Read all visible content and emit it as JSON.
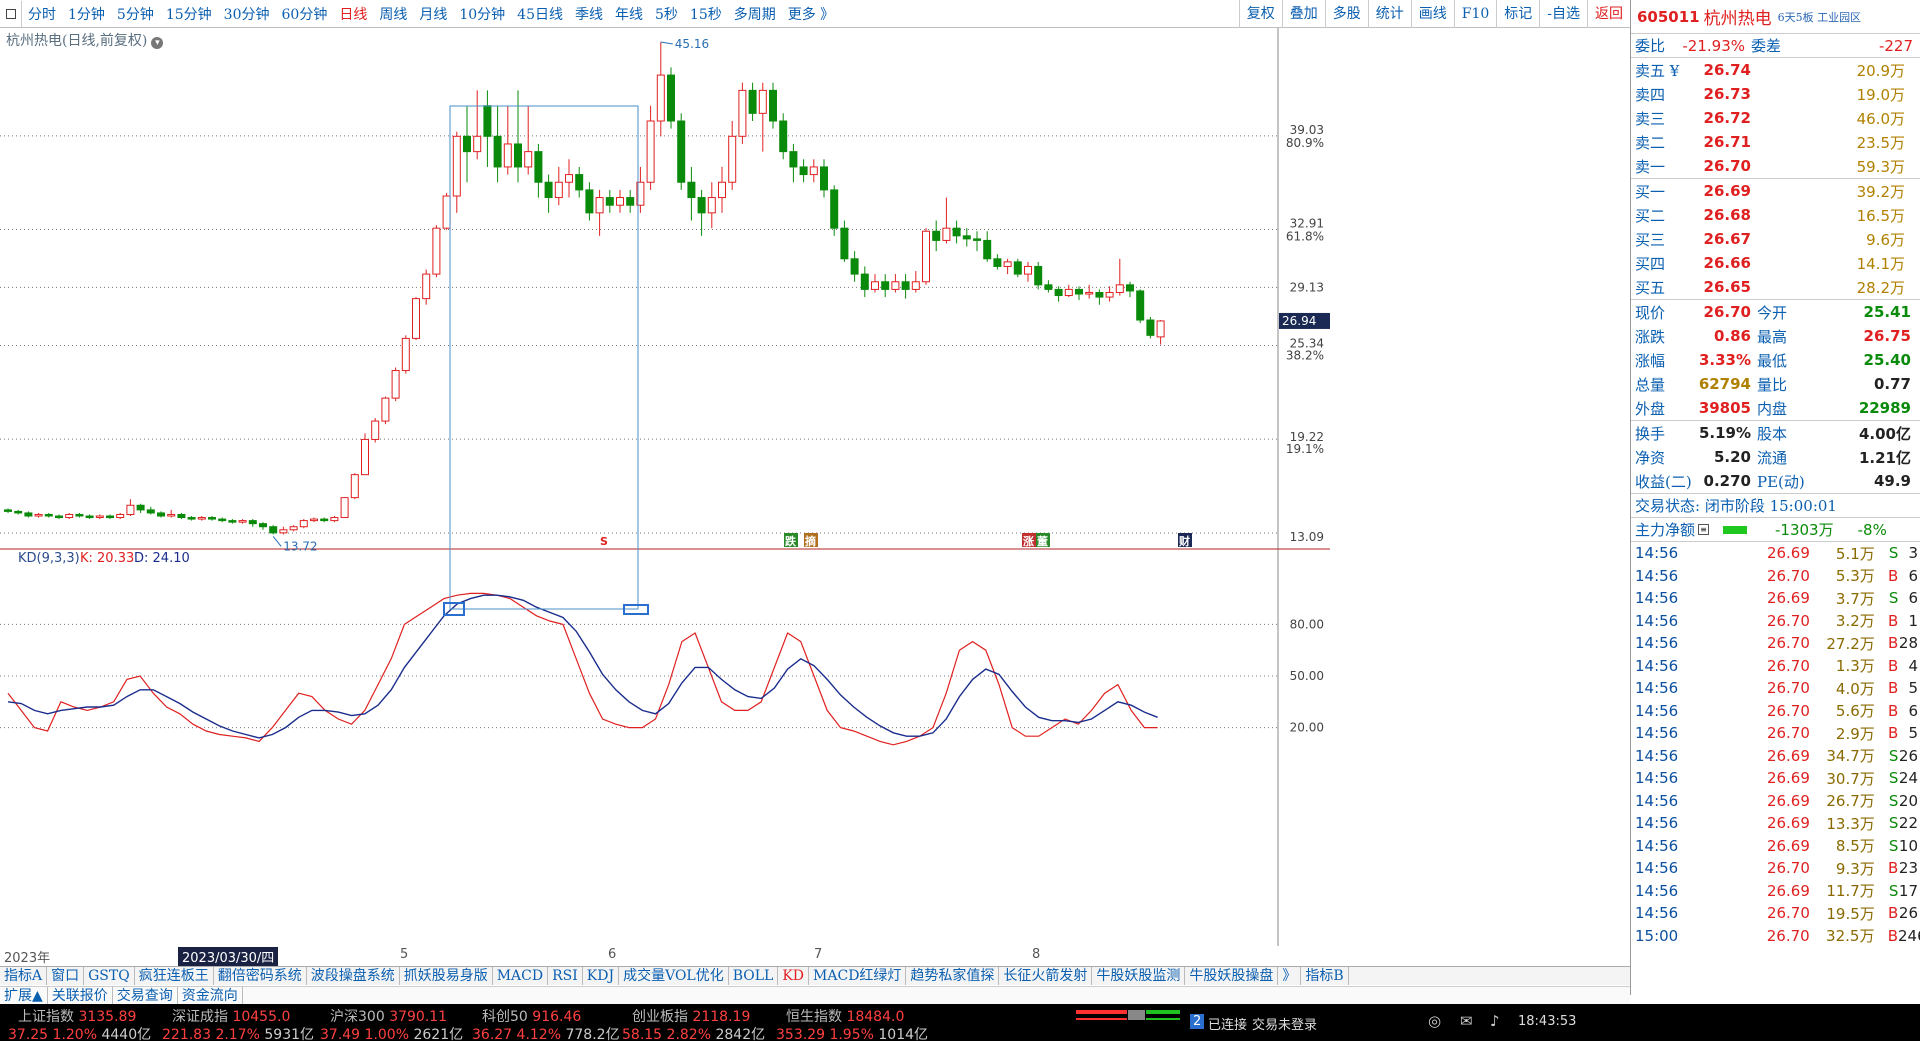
{
  "toolbar": {
    "periods": [
      "分时",
      "1分钟",
      "5分钟",
      "15分钟",
      "30分钟",
      "60分钟",
      "日线",
      "周线",
      "月线",
      "10分钟",
      "45日线",
      "季线",
      "年线",
      "5秒",
      "15秒",
      "多周期",
      "更多 》"
    ],
    "active_period": "日线",
    "right": [
      "复权",
      "叠加",
      "多股",
      "统计",
      "画线",
      "F10",
      "标记",
      "-自选",
      "返回"
    ]
  },
  "chart": {
    "title": "杭州热电(日线,前复权)",
    "price_labels": [
      "39.03",
      "80.9%",
      "32.91",
      "61.8%",
      "29.13",
      "25.34",
      "38.2%",
      "19.22",
      "19.1%",
      "13.09"
    ],
    "current_price_tag": "26.94",
    "high_label": "45.16",
    "low_label": "13.72",
    "event_markers": [
      "S",
      "跌",
      "摘",
      "涨",
      "董",
      "财"
    ],
    "kd_label": "KD(9,3,3)",
    "kd_k": "K: 20.33",
    "kd_d": "D: 24.10",
    "kd_levels": [
      "80.00",
      "50.00",
      "20.00"
    ],
    "x_labels": [
      "2023年",
      "2023/03/30/四",
      "5",
      "6",
      "7",
      "8"
    ]
  },
  "chart_data": {
    "type": "candlestick",
    "title": "杭州热电(日线,前复权)",
    "ylim": [
      13.09,
      45.16
    ],
    "candles": [
      [
        14.6,
        14.5,
        14.7,
        14.4
      ],
      [
        14.5,
        14.4,
        14.6,
        14.3
      ],
      [
        14.4,
        14.2,
        14.5,
        14.1
      ],
      [
        14.2,
        14.3,
        14.4,
        14.1
      ],
      [
        14.3,
        14.2,
        14.4,
        14.1
      ],
      [
        14.2,
        14.1,
        14.3,
        14.0
      ],
      [
        14.1,
        14.3,
        14.4,
        14.0
      ],
      [
        14.3,
        14.2,
        14.4,
        14.1
      ],
      [
        14.2,
        14.1,
        14.3,
        14.0
      ],
      [
        14.1,
        14.2,
        14.3,
        14.0
      ],
      [
        14.2,
        14.1,
        14.3,
        14.0
      ],
      [
        14.1,
        14.3,
        14.4,
        14.0
      ],
      [
        14.3,
        14.9,
        15.3,
        14.2
      ],
      [
        14.9,
        14.6,
        15.0,
        14.4
      ],
      [
        14.6,
        14.4,
        14.8,
        14.3
      ],
      [
        14.4,
        14.2,
        14.5,
        14.1
      ],
      [
        14.2,
        14.3,
        14.6,
        14.1
      ],
      [
        14.3,
        14.1,
        14.4,
        14.0
      ],
      [
        14.1,
        14.0,
        14.2,
        13.9
      ],
      [
        14.0,
        14.1,
        14.2,
        13.9
      ],
      [
        14.1,
        14.0,
        14.2,
        13.9
      ],
      [
        14.0,
        13.9,
        14.1,
        13.8
      ],
      [
        13.9,
        13.8,
        14.0,
        13.7
      ],
      [
        13.8,
        13.9,
        14.0,
        13.7
      ],
      [
        13.9,
        13.7,
        14.0,
        13.5
      ],
      [
        13.7,
        13.5,
        13.8,
        13.3
      ],
      [
        13.5,
        13.1,
        13.6,
        13.0
      ],
      [
        13.1,
        13.3,
        13.5,
        13.0
      ],
      [
        13.3,
        13.5,
        13.6,
        13.2
      ],
      [
        13.5,
        13.9,
        14.0,
        13.4
      ],
      [
        13.9,
        14.0,
        14.1,
        13.8
      ],
      [
        14.0,
        13.9,
        14.1,
        13.8
      ],
      [
        13.9,
        14.1,
        14.2,
        13.8
      ],
      [
        14.1,
        15.4,
        15.4,
        14.1
      ],
      [
        15.4,
        16.9,
        17.0,
        15.3
      ],
      [
        16.9,
        19.2,
        19.6,
        16.9
      ],
      [
        19.2,
        20.4,
        20.6,
        19.0
      ],
      [
        20.4,
        21.9,
        22.0,
        20.2
      ],
      [
        21.9,
        23.7,
        23.9,
        21.7
      ],
      [
        23.7,
        25.8,
        26.0,
        23.5
      ],
      [
        25.8,
        28.4,
        28.5,
        25.7
      ],
      [
        28.4,
        30.0,
        30.3,
        28.0
      ],
      [
        30.0,
        33.0,
        33.2,
        29.8
      ],
      [
        33.0,
        35.1,
        35.3,
        32.9
      ],
      [
        35.1,
        39.0,
        39.3,
        34.0
      ],
      [
        39.0,
        38.0,
        41.0,
        36.0
      ],
      [
        38.0,
        39.0,
        42.0,
        37.5
      ],
      [
        41.0,
        39.0,
        42.0,
        37.0
      ],
      [
        39.0,
        37.0,
        41.0,
        36.0
      ],
      [
        37.0,
        38.5,
        41.0,
        36.5
      ],
      [
        38.5,
        37.0,
        42.0,
        36.0
      ],
      [
        37.0,
        38.0,
        41.0,
        36.5
      ],
      [
        38.0,
        36.0,
        38.5,
        35.0
      ],
      [
        36.0,
        35.0,
        36.5,
        34.0
      ],
      [
        35.0,
        36.0,
        37.0,
        34.5
      ],
      [
        36.0,
        36.5,
        37.5,
        35.0
      ],
      [
        36.5,
        35.5,
        37.0,
        35.0
      ],
      [
        35.5,
        34.0,
        36.0,
        33.5
      ],
      [
        34.0,
        35.0,
        35.5,
        32.5
      ],
      [
        35.0,
        34.5,
        35.5,
        34.0
      ],
      [
        34.5,
        35.0,
        35.5,
        34.0
      ],
      [
        35.0,
        34.5,
        35.5,
        34.0
      ],
      [
        34.5,
        36.0,
        37.0,
        34.0
      ],
      [
        36.0,
        40.0,
        41.0,
        35.5
      ],
      [
        40.0,
        43.0,
        45.16,
        39.0
      ],
      [
        43.0,
        40.0,
        43.5,
        39.5
      ],
      [
        40.0,
        36.0,
        40.5,
        35.5
      ],
      [
        36.0,
        35.0,
        37.0,
        33.5
      ],
      [
        35.0,
        34.0,
        35.5,
        32.5
      ],
      [
        34.0,
        35.0,
        36.0,
        33.0
      ],
      [
        35.0,
        36.0,
        37.0,
        34.0
      ],
      [
        36.0,
        39.0,
        40.0,
        35.5
      ],
      [
        39.0,
        42.0,
        42.5,
        38.5
      ],
      [
        42.0,
        40.5,
        42.5,
        40.0
      ],
      [
        40.5,
        42.0,
        42.5,
        38.0
      ],
      [
        42.0,
        40.0,
        42.5,
        39.5
      ],
      [
        40.0,
        38.0,
        40.5,
        37.5
      ],
      [
        38.0,
        37.0,
        38.5,
        36.0
      ],
      [
        37.0,
        36.5,
        37.5,
        36.0
      ],
      [
        36.5,
        37.0,
        37.5,
        36.0
      ],
      [
        37.0,
        35.5,
        37.5,
        35.0
      ],
      [
        35.5,
        33.0,
        35.8,
        32.5
      ],
      [
        33.0,
        31.0,
        33.5,
        30.8
      ],
      [
        31.0,
        30.0,
        31.5,
        29.5
      ],
      [
        30.0,
        29.0,
        30.5,
        28.5
      ],
      [
        29.0,
        29.5,
        30.0,
        28.8
      ],
      [
        29.5,
        29.0,
        30.0,
        28.5
      ],
      [
        29.0,
        29.5,
        30.0,
        28.8
      ],
      [
        29.5,
        29.0,
        30.0,
        28.4
      ],
      [
        29.0,
        29.5,
        30.2,
        28.8
      ],
      [
        29.5,
        32.8,
        33.0,
        29.3
      ],
      [
        32.8,
        32.2,
        33.5,
        31.5
      ],
      [
        32.2,
        33.0,
        35.0,
        32.0
      ],
      [
        33.0,
        32.5,
        33.5,
        32.0
      ],
      [
        32.5,
        32.3,
        33.0,
        31.8
      ],
      [
        32.3,
        32.2,
        32.8,
        31.5
      ],
      [
        32.2,
        31.0,
        32.8,
        30.8
      ],
      [
        31.0,
        30.5,
        31.3,
        30.3
      ],
      [
        30.5,
        30.8,
        31.0,
        30.0
      ],
      [
        30.8,
        30.0,
        31.0,
        29.8
      ],
      [
        30.0,
        30.5,
        30.8,
        29.5
      ],
      [
        30.5,
        29.3,
        30.8,
        29.0
      ],
      [
        29.3,
        29.0,
        29.6,
        28.8
      ],
      [
        29.0,
        28.6,
        29.2,
        28.2
      ],
      [
        28.6,
        29.0,
        29.3,
        28.5
      ],
      [
        29.0,
        28.7,
        29.2,
        28.3
      ],
      [
        28.7,
        28.8,
        29.3,
        28.4
      ],
      [
        28.8,
        28.5,
        29.0,
        28.0
      ],
      [
        28.5,
        28.8,
        29.2,
        28.2
      ],
      [
        28.8,
        29.3,
        31.0,
        28.6
      ],
      [
        29.3,
        28.9,
        29.5,
        28.5
      ],
      [
        28.9,
        27.0,
        29.0,
        26.8
      ],
      [
        27.0,
        26.0,
        27.2,
        25.8
      ],
      [
        25.9,
        26.94,
        27.0,
        25.4
      ]
    ],
    "kd": {
      "k": [
        40,
        30,
        20,
        18,
        35,
        32,
        30,
        32,
        35,
        48,
        50,
        40,
        32,
        28,
        22,
        18,
        16,
        15,
        14,
        12,
        20,
        30,
        40,
        38,
        30,
        25,
        22,
        30,
        45,
        60,
        80,
        85,
        90,
        95,
        97,
        98,
        98,
        97,
        95,
        90,
        85,
        82,
        80,
        60,
        40,
        25,
        22,
        20,
        20,
        25,
        45,
        70,
        75,
        55,
        35,
        30,
        30,
        35,
        55,
        75,
        70,
        50,
        30,
        20,
        18,
        15,
        12,
        10,
        12,
        15,
        20,
        40,
        65,
        70,
        65,
        45,
        20,
        15,
        15,
        20,
        25,
        22,
        30,
        40,
        45,
        30,
        20,
        20
      ],
      "d": [
        35,
        34,
        30,
        28,
        30,
        31,
        32,
        32,
        33,
        38,
        42,
        42,
        38,
        34,
        29,
        25,
        21,
        18,
        16,
        14,
        16,
        20,
        26,
        30,
        30,
        29,
        27,
        28,
        33,
        42,
        55,
        65,
        75,
        85,
        92,
        95,
        97,
        97,
        96,
        94,
        90,
        87,
        84,
        76,
        64,
        51,
        42,
        35,
        30,
        28,
        34,
        46,
        55,
        55,
        48,
        42,
        38,
        37,
        43,
        54,
        60,
        56,
        48,
        39,
        32,
        26,
        21,
        17,
        15,
        15,
        17,
        25,
        38,
        48,
        54,
        51,
        41,
        32,
        26,
        24,
        24,
        23,
        25,
        30,
        35,
        33,
        29,
        26
      ]
    }
  },
  "quote": {
    "code": "605011",
    "name": "杭州热电",
    "industry": "6天5板 工业园区",
    "weibi_label": "委比",
    "weibi_value": "-21.93%",
    "weicha_label": "委差",
    "weicha_value": "-227",
    "asks": [
      {
        "label": "卖五 ¥",
        "price": "26.74",
        "vol": "20.9万"
      },
      {
        "label": "卖四",
        "price": "26.73",
        "vol": "19.0万"
      },
      {
        "label": "卖三",
        "price": "26.72",
        "vol": "46.0万"
      },
      {
        "label": "卖二",
        "price": "26.71",
        "vol": "23.5万"
      },
      {
        "label": "卖一",
        "price": "26.70",
        "vol": "59.3万"
      }
    ],
    "bids": [
      {
        "label": "买一",
        "price": "26.69",
        "vol": "39.2万"
      },
      {
        "label": "买二",
        "price": "26.68",
        "vol": "16.5万"
      },
      {
        "label": "买三",
        "price": "26.67",
        "vol": "9.6万"
      },
      {
        "label": "买四",
        "price": "26.66",
        "vol": "14.1万"
      },
      {
        "label": "买五",
        "price": "26.65",
        "vol": "28.2万"
      }
    ],
    "stats": [
      {
        "l1": "现价",
        "v1": "26.70",
        "c1": "red",
        "l2": "今开",
        "v2": "25.41",
        "c2": "green"
      },
      {
        "l1": "涨跌",
        "v1": "0.86",
        "c1": "red",
        "l2": "最高",
        "v2": "26.75",
        "c2": "red"
      },
      {
        "l1": "涨幅",
        "v1": "3.33%",
        "c1": "red",
        "l2": "最低",
        "v2": "25.40",
        "c2": "green"
      },
      {
        "l1": "总量",
        "v1": "62794",
        "c1": "gold",
        "l2": "量比",
        "v2": "0.77",
        "c2": "dark"
      },
      {
        "l1": "外盘",
        "v1": "39805",
        "c1": "red",
        "l2": "内盘",
        "v2": "22989",
        "c2": "green"
      }
    ],
    "stats2": [
      {
        "l1": "换手",
        "v1": "5.19%",
        "c1": "dark",
        "l2": "股本",
        "v2": "4.00亿",
        "c2": "dark"
      },
      {
        "l1": "净资",
        "v1": "5.20",
        "c1": "dark",
        "l2": "流通",
        "v2": "1.21亿",
        "c2": "dark"
      },
      {
        "l1": "收益(二)",
        "v1": "0.270",
        "c1": "dark",
        "l2": "PE(动)",
        "v2": "49.9",
        "c2": "dark"
      }
    ],
    "trade_state": "交易状态: 闭市阶段 15:00:01",
    "main_net_label": "主力净额",
    "main_net_value": "-1303万",
    "main_net_pct": "-8%"
  },
  "ticks": [
    {
      "t": "14:56",
      "p": "26.69",
      "v": "5.1万",
      "bs": "S",
      "n": "3"
    },
    {
      "t": "14:56",
      "p": "26.70",
      "v": "5.3万",
      "bs": "B",
      "n": "6"
    },
    {
      "t": "14:56",
      "p": "26.69",
      "v": "3.7万",
      "bs": "S",
      "n": "6"
    },
    {
      "t": "14:56",
      "p": "26.70",
      "v": "3.2万",
      "bs": "B",
      "n": "1"
    },
    {
      "t": "14:56",
      "p": "26.70",
      "v": "27.2万",
      "bs": "B",
      "n": "28"
    },
    {
      "t": "14:56",
      "p": "26.70",
      "v": "1.3万",
      "bs": "B",
      "n": "4"
    },
    {
      "t": "14:56",
      "p": "26.70",
      "v": "4.0万",
      "bs": "B",
      "n": "5"
    },
    {
      "t": "14:56",
      "p": "26.70",
      "v": "5.6万",
      "bs": "B",
      "n": "6"
    },
    {
      "t": "14:56",
      "p": "26.70",
      "v": "2.9万",
      "bs": "B",
      "n": "5"
    },
    {
      "t": "14:56",
      "p": "26.69",
      "v": "34.7万",
      "bs": "S",
      "n": "26"
    },
    {
      "t": "14:56",
      "p": "26.69",
      "v": "30.7万",
      "bs": "S",
      "n": "24"
    },
    {
      "t": "14:56",
      "p": "26.69",
      "v": "26.7万",
      "bs": "S",
      "n": "20"
    },
    {
      "t": "14:56",
      "p": "26.69",
      "v": "13.3万",
      "bs": "S",
      "n": "22"
    },
    {
      "t": "14:56",
      "p": "26.69",
      "v": "8.5万",
      "bs": "S",
      "n": "10"
    },
    {
      "t": "14:56",
      "p": "26.70",
      "v": "9.3万",
      "bs": "B",
      "n": "23"
    },
    {
      "t": "14:56",
      "p": "26.69",
      "v": "11.7万",
      "bs": "S",
      "n": "17"
    },
    {
      "t": "14:56",
      "p": "26.70",
      "v": "19.5万",
      "bs": "B",
      "n": "26"
    },
    {
      "t": "15:00",
      "p": "26.70",
      "v": "32.5万",
      "bs": "B",
      "n": "246"
    }
  ],
  "tabs1": [
    "指标A",
    "窗口",
    "GSTQ",
    "疯狂连板王",
    "翻倍密码系统",
    "波段操盘系统",
    "抓妖股易身版",
    "MACD",
    "RSI",
    "KDJ",
    "成交量VOL优化",
    "BOLL",
    "KD",
    "MACD红绿灯",
    "趋势私家值探",
    "长征火箭发射",
    "牛股妖股监测",
    "牛股妖股操盘",
    "》",
    "指标B"
  ],
  "tabs1_active": "KD",
  "tabs2": [
    "扩展▲",
    "关联报价",
    "交易查询",
    "资金流向"
  ],
  "status": {
    "indices": [
      {
        "name": "上证指数",
        "value": "3135.89",
        "chg": "37.25",
        "pct": "1.20%",
        "amt": "4440亿"
      },
      {
        "name": "深证成指",
        "value": "10455.0",
        "chg": "221.83",
        "pct": "2.17%",
        "amt": "5931亿"
      },
      {
        "name": "沪深300",
        "value": "3790.11",
        "chg": "37.49",
        "pct": "1.00%",
        "amt": "2621亿"
      },
      {
        "name": "科创50",
        "value": "916.46",
        "chg": "36.27",
        "pct": "4.12%",
        "amt": "778.2亿"
      },
      {
        "name": "创业板指",
        "value": "2118.19",
        "chg": "58.15",
        "pct": "2.82%",
        "amt": "2842亿"
      },
      {
        "name": "恒生指数",
        "value": "18484.0",
        "chg": "353.29",
        "pct": "1.95%",
        "amt": "1014亿"
      }
    ],
    "connected": "已连接",
    "login": "交易未登录",
    "badge": "2",
    "time": "18:43:53"
  },
  "colors": {
    "up": "#e02020",
    "down": "#0a8a0a",
    "link": "#0b5fb0",
    "kd_k": "#e02020",
    "kd_d": "#1a2d8c"
  }
}
